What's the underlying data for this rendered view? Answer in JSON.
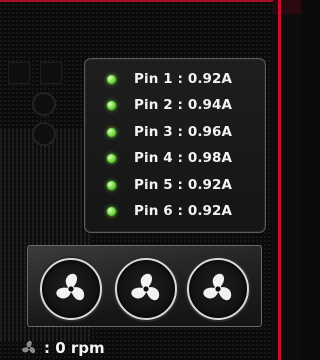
{
  "pins": [
    {
      "label": "Pin 1 : 0.92A",
      "status_color": "#7fe04a"
    },
    {
      "label": "Pin 2 : 0.94A",
      "status_color": "#7fe04a"
    },
    {
      "label": "Pin 3 : 0.96A",
      "status_color": "#7fe04a"
    },
    {
      "label": "Pin 4 : 0.98A",
      "status_color": "#7fe04a"
    },
    {
      "label": "Pin 5 : 0.92A",
      "status_color": "#7fe04a"
    },
    {
      "label": "Pin 6 : 0.92A",
      "status_color": "#7fe04a"
    }
  ],
  "fans": [
    {
      "icon": "fan-icon"
    },
    {
      "icon": "fan-icon"
    },
    {
      "icon": "fan-icon"
    }
  ],
  "fan_speed": {
    "icon": "fan-icon",
    "text": ": 0 rpm"
  },
  "colors": {
    "accent": "#c8102e",
    "status_ok": "#7fe04a"
  }
}
